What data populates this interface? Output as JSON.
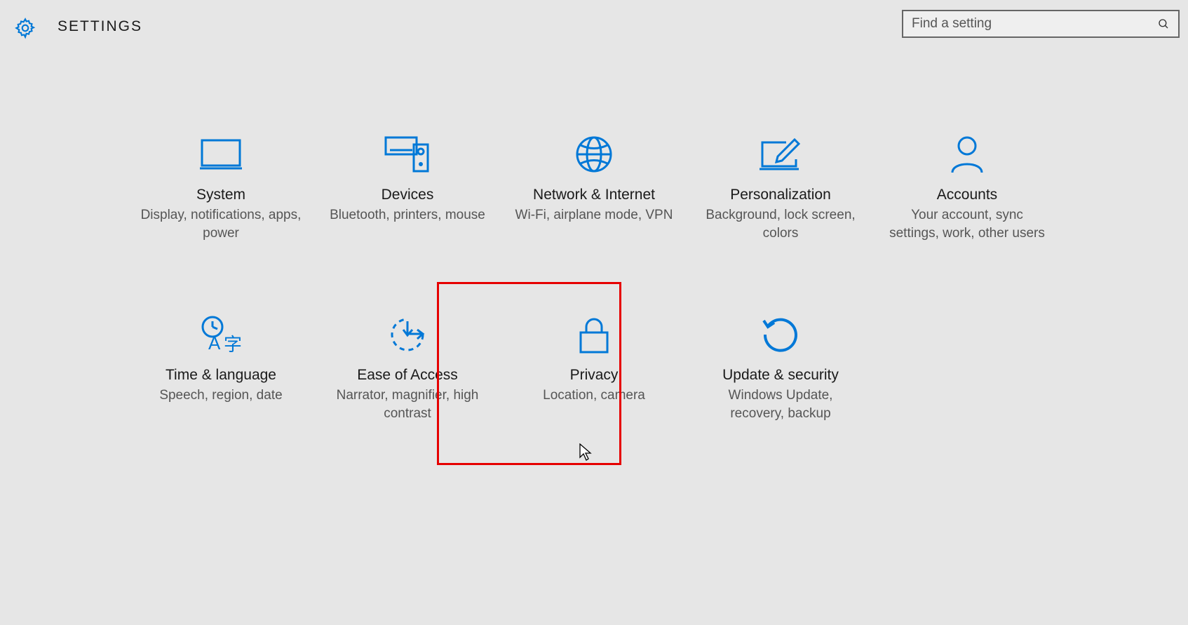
{
  "header": {
    "title": "SETTINGS"
  },
  "search": {
    "placeholder": "Find a setting"
  },
  "tiles": [
    {
      "title": "System",
      "desc": "Display, notifications, apps, power"
    },
    {
      "title": "Devices",
      "desc": "Bluetooth, printers, mouse"
    },
    {
      "title": "Network & Internet",
      "desc": "Wi-Fi, airplane mode, VPN"
    },
    {
      "title": "Personalization",
      "desc": "Background, lock screen, colors"
    },
    {
      "title": "Accounts",
      "desc": "Your account, sync settings, work, other users"
    },
    {
      "title": "Time & language",
      "desc": "Speech, region, date"
    },
    {
      "title": "Ease of Access",
      "desc": "Narrator, magnifier, high contrast"
    },
    {
      "title": "Privacy",
      "desc": "Location, camera"
    },
    {
      "title": "Update & security",
      "desc": "Windows Update, recovery, backup"
    }
  ],
  "highlighted_tile_index": 7
}
